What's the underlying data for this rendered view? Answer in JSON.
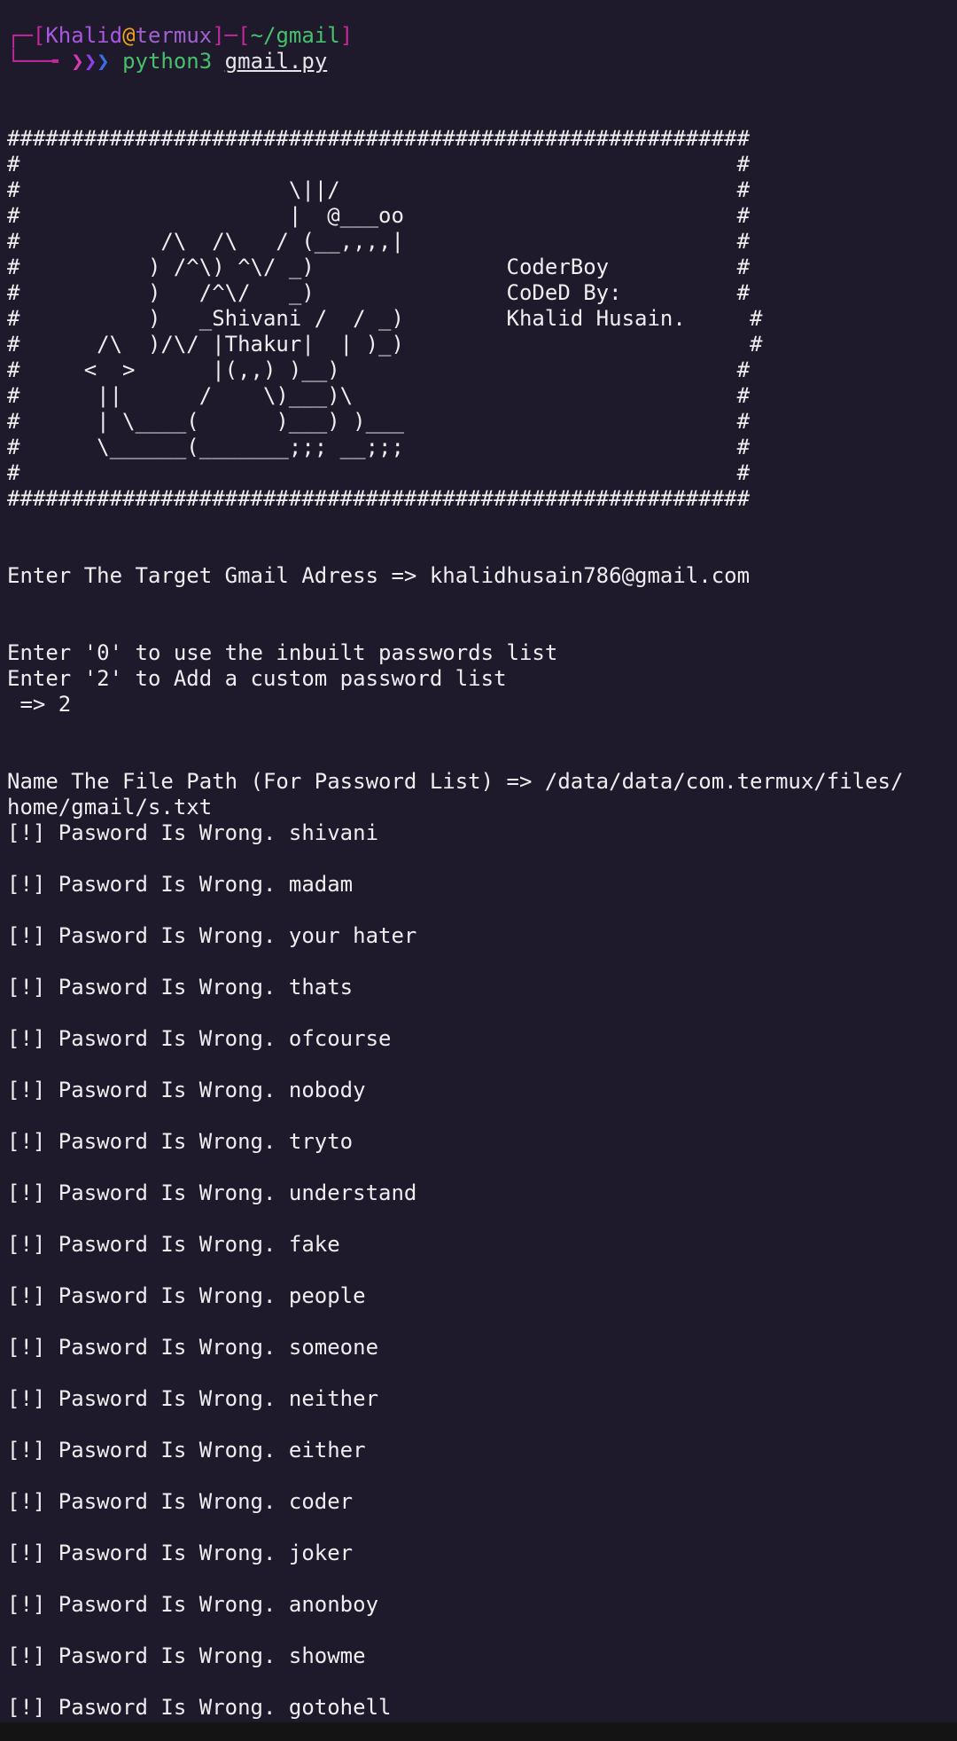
{
  "prompt": {
    "frame_open": "┌─[",
    "user": "Khalid",
    "at": "@",
    "host": "termux",
    "frame_mid": "]─[",
    "dir": "~/gmail",
    "frame_close": "]",
    "frame_bottom": "└──╼",
    "arrows": [
      "❯",
      "❯",
      "❯"
    ],
    "command": "python3",
    "argument": "gmail.py"
  },
  "banner": [
    "##########################################################",
    "#                                                        #",
    "#                     \\||/                               #",
    "#                     |  @___oo                          #",
    "#           /\\  /\\   / (__,,,,|                          #",
    "#          ) /^\\) ^\\/ _)               CoderBoy          #",
    "#          )   /^\\/   _)               CoDeD By:         #",
    "#          )   _Shivani /  / _)        Khalid Husain.     #",
    "#      /\\  )/\\/ |Thakur|  | )_)                           #",
    "#     <  >      |(,,) )__)                               #",
    "#      ||      /    \\)___)\\                              #",
    "#      | \\____(      )___) )___                          #",
    "#      \\______(_______;;; __;;;                          #",
    "#                                                        #",
    "##########################################################"
  ],
  "target_prompt": "Enter The Target Gmail Adress => khalidhusain786@gmail.com",
  "menu": [
    "Enter '0' to use the inbuilt passwords list",
    "Enter '2' to Add a custom password list",
    " => 2"
  ],
  "file_path_lines": [
    "Name The File Path (For Password List) => /data/data/com.termux/files/",
    "home/gmail/s.txt"
  ],
  "attempt_prefix": "[!] Pasword Is Wrong. ",
  "attempts": [
    "shivani",
    "madam",
    "your hater",
    "thats",
    "ofcourse",
    "nobody",
    "tryto",
    "understand",
    "fake",
    "people",
    "someone",
    "neither",
    "either",
    "coder",
    "joker",
    "anonboy",
    "showme",
    "gotohell"
  ],
  "attempt_lines": [
    "[!] Pasword Is Wrong. shivani",
    "[!] Pasword Is Wrong. madam",
    "[!] Pasword Is Wrong. your hater",
    "[!] Pasword Is Wrong. thats",
    "[!] Pasword Is Wrong. ofcourse",
    "[!] Pasword Is Wrong. nobody",
    "[!] Pasword Is Wrong. tryto",
    "[!] Pasword Is Wrong. understand",
    "[!] Pasword Is Wrong. fake",
    "[!] Pasword Is Wrong. people",
    "[!] Pasword Is Wrong. someone",
    "[!] Pasword Is Wrong. neither",
    "[!] Pasword Is Wrong. either",
    "[!] Pasword Is Wrong. coder",
    "[!] Pasword Is Wrong. joker",
    "[!] Pasword Is Wrong. anonboy",
    "[!] Pasword Is Wrong. showme",
    "[!] Pasword Is Wrong. gotohell"
  ],
  "colors": {
    "background": "#1e1a2b",
    "text": "#eeeeee",
    "prompt_frame": "#c2289a",
    "prompt_user": "#a857e0",
    "prompt_at": "#f0a21a",
    "prompt_dir": "#46c06a"
  }
}
